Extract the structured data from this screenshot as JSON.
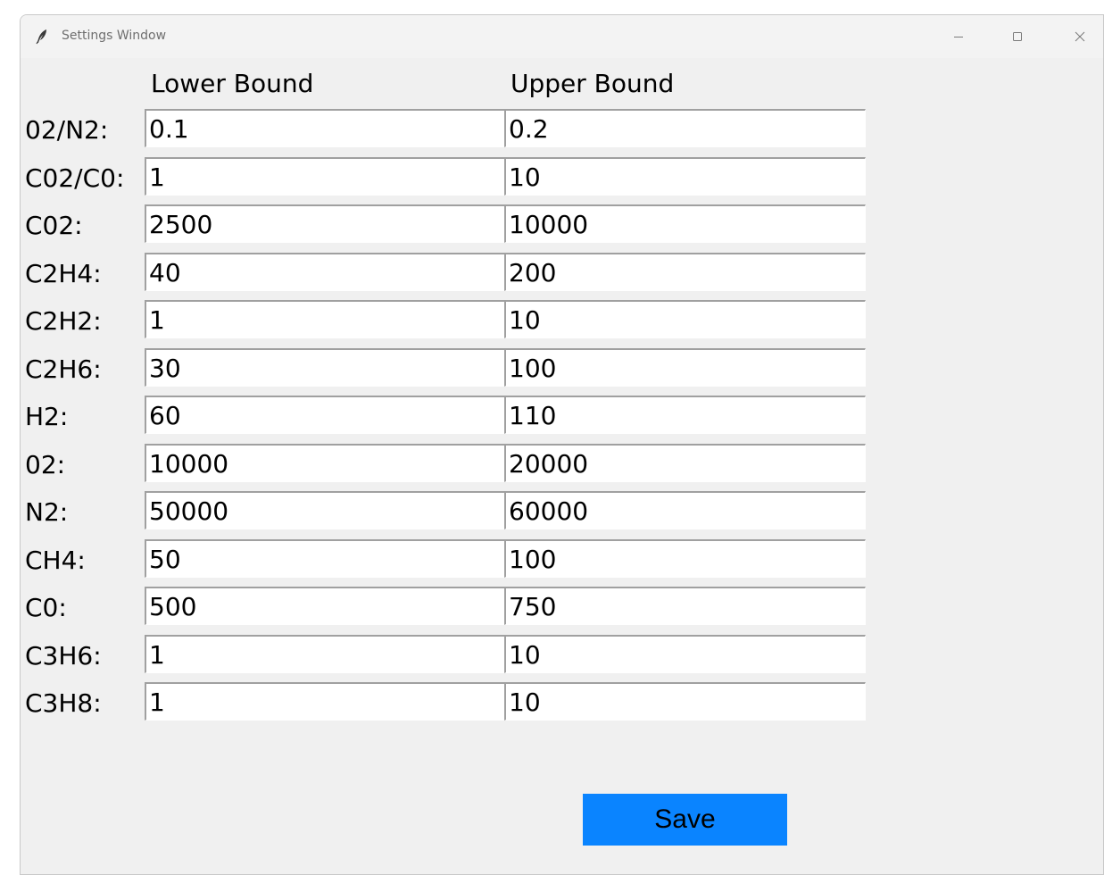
{
  "window": {
    "title": "Settings Window",
    "app_icon": "feather-icon",
    "controls": {
      "minimize_icon": "minimize-icon",
      "maximize_icon": "maximize-icon",
      "close_icon": "close-icon"
    }
  },
  "headers": {
    "lower": "Lower Bound",
    "upper": "Upper Bound"
  },
  "rows": [
    {
      "label": "02/N2:",
      "lower": "0.1",
      "upper": "0.2"
    },
    {
      "label": "C02/C0:",
      "lower": "1",
      "upper": "10"
    },
    {
      "label": "C02:",
      "lower": "2500",
      "upper": "10000"
    },
    {
      "label": "C2H4:",
      "lower": "40",
      "upper": "200"
    },
    {
      "label": "C2H2:",
      "lower": "1",
      "upper": "10"
    },
    {
      "label": "C2H6:",
      "lower": "30",
      "upper": "100"
    },
    {
      "label": "H2:",
      "lower": "60",
      "upper": "110"
    },
    {
      "label": "02:",
      "lower": "10000",
      "upper": "20000"
    },
    {
      "label": "N2:",
      "lower": "50000",
      "upper": "60000"
    },
    {
      "label": "CH4:",
      "lower": "50",
      "upper": "100"
    },
    {
      "label": "C0:",
      "lower": "500",
      "upper": "750"
    },
    {
      "label": "C3H6:",
      "lower": "1",
      "upper": "10"
    },
    {
      "label": "C3H8:",
      "lower": "1",
      "upper": "10"
    }
  ],
  "save_button": {
    "label": "Save",
    "color": "#0a84ff"
  }
}
